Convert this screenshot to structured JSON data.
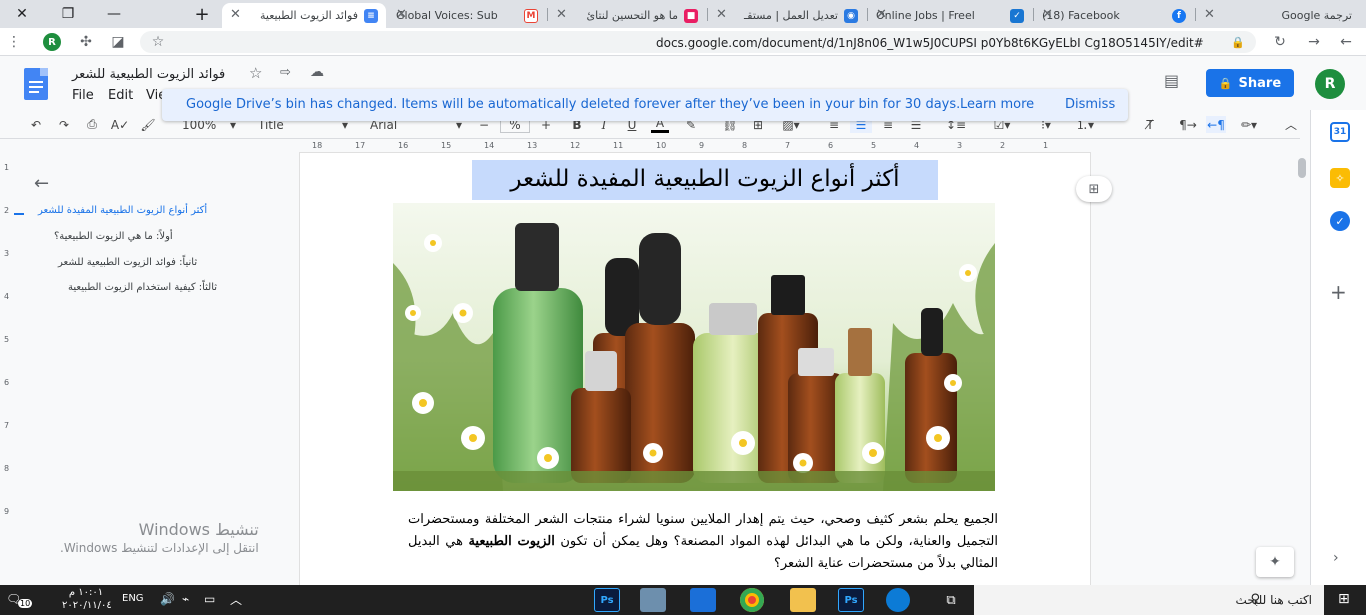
{
  "browser": {
    "tabs": [
      {
        "title": "فوائد الزيوت الطبيعية",
        "favicon_color": "#4285f4",
        "favicon": "doc-icon",
        "active": true
      },
      {
        "title": "Global Voices: Sub",
        "favicon_color": "#ea4335",
        "favicon": "gmail-icon",
        "active": false
      },
      {
        "title": "ما هو التحسين لنتائ",
        "favicon_color": "#e91e63",
        "favicon": "site-icon",
        "active": false
      },
      {
        "title": "تعديل العمل | مستقـ",
        "favicon_color": "#2a7ae2",
        "favicon": "site-icon",
        "active": false
      },
      {
        "title": "Online Jobs | Freel",
        "favicon_color": "#1976d2",
        "favicon": "site-icon",
        "active": false
      },
      {
        "title": "(18) Facebook",
        "favicon_color": "#1877f2",
        "favicon": "facebook-icon",
        "active": false
      },
      {
        "title": "ترجمة Google",
        "favicon_color": "#4285f4",
        "favicon": "translate-icon",
        "active": false
      }
    ],
    "url": "docs.google.com/document/d/1nJ8n06_W1w5J0CUPSI p0Yb8t6KGyELbI Cg18O5145IY/edit#",
    "profile_letter": "R"
  },
  "docs": {
    "title": "فوائد الزيوت الطبيعية للشعر",
    "menus": [
      "File",
      "Edit",
      "Vie"
    ],
    "share_label": "Share",
    "avatar_letter": "R",
    "toolbar": {
      "zoom": "100%",
      "style": "Title",
      "font": "Arial",
      "font_size": "%",
      "minus": "−",
      "plus": "+"
    }
  },
  "notice": {
    "message": "Google Drive’s bin has changed. Items will be automatically deleted forever after they’ve been in your bin for 30 days.",
    "learn_more": "Learn more",
    "dismiss": "Dismiss"
  },
  "ruler": {
    "labels": [
      "18",
      "17",
      "16",
      "15",
      "14",
      "13",
      "12",
      "11",
      "10",
      "9",
      "8",
      "7",
      "6",
      "5",
      "4",
      "3",
      "2",
      "1"
    ],
    "vlabels": [
      "1",
      "2",
      "3",
      "4",
      "5",
      "6",
      "7",
      "8",
      "9"
    ]
  },
  "outline": {
    "items": [
      {
        "text": "أكثر أنواع الزيوت الطبيعية المفيدة للشعر",
        "level": 1,
        "active": true
      },
      {
        "text": "أولاً: ما هي الزيوت الطبيعية؟",
        "level": 2,
        "active": false
      },
      {
        "text": "ثانياً: فوائد الزيوت الطبيعية للشعر",
        "level": 3,
        "active": false
      },
      {
        "text": "ثالثاً: كيفية استخدام الزيوت الطبيعية",
        "level": 3,
        "active": false
      }
    ]
  },
  "document": {
    "heading": "أكثر أنواع الزيوت الطبيعية المفيدة للشعر",
    "paragraph_before": "الجميع يحلم بشعر كثيف وصحي، حيث يتم إهدار الملايين سنويا لشراء منتجات الشعر المختلفة ومستحضرات التجميل والعناية، ولكن ما هي البدائل لهذه المواد المصنعة؟ وهل يمكن أن تكون ",
    "paragraph_bold": "الزيوت الطبيعية",
    "paragraph_after": " هي البديل المثالي بدلاً من مستحضرات عناية الشعر؟"
  },
  "watermark": {
    "line1": "تنشيط Windows",
    "line2": "انتقل إلى الإعدادات لتنشيط Windows."
  },
  "taskbar": {
    "search_placeholder": "اكتب هنا للبحث",
    "time": "١٠:٠١ م",
    "date": "٢٠٢٠/١١/٠٤",
    "lang": "ENG",
    "notif_count": "10"
  },
  "colors": {
    "accent": "#1a73e8",
    "notice_bg": "#e8f0fe",
    "heading_highlight": "#c6dafc",
    "taskbar": "#202020"
  }
}
